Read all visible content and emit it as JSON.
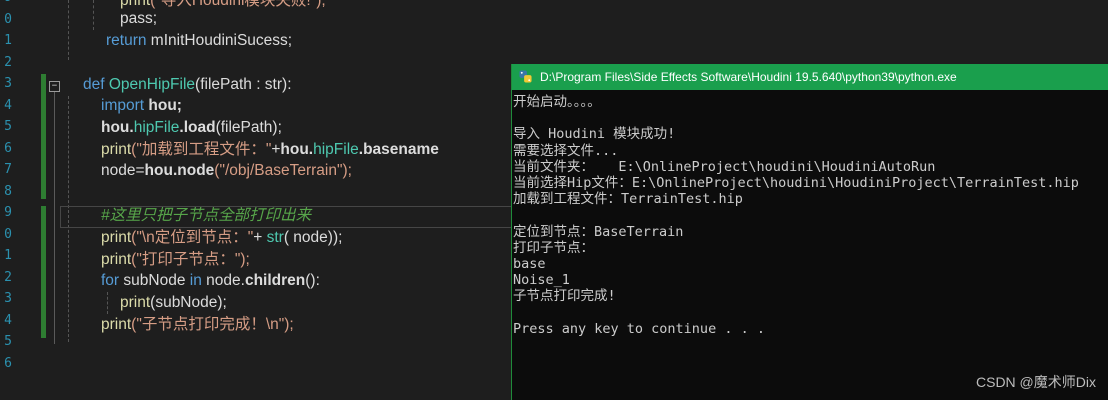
{
  "editor": {
    "line_numbers": [
      "9",
      "0",
      "1",
      "2",
      "3",
      "4",
      "5",
      "6",
      "7",
      "8",
      "9",
      "0",
      "1",
      "2",
      "3",
      "4",
      "5",
      "6"
    ],
    "code": {
      "l0_print": "print",
      "l0_str": "(\"导入Houdini模块失败!\");",
      "l1": "pass;",
      "l2_kw": "return",
      "l2_rest": " mInitHoudiniSucess;",
      "l4_kw": "def",
      "l4_fn": "OpenHipFile",
      "l4_rest": "(filePath : str):",
      "l5_kw": "import",
      "l5_rest": " hou;",
      "l6_a": "hou.",
      "l6_b": "hipFile",
      "l6_c": ".load",
      "l6_d": "(filePath);",
      "l7_print": "print",
      "l7_str": "(\"加载到工程文件：\"",
      "l7_plus": "+",
      "l7_a": "hou.",
      "l7_b": "hipFile",
      "l7_c": ".basename",
      "l8_a": "node=",
      "l8_b": "hou.node",
      "l8_c": "(\"/obj/BaseTerrain\");",
      "l10_cm": "#这里只把子节点全部打印出来",
      "l11_print": "print",
      "l11_str": "(\"\\n定位到节点：\"",
      "l11_plus": "+ ",
      "l11_fn": "str",
      "l11_rest": "( node));",
      "l12_print": "print",
      "l12_str": "(\"打印子节点：\");",
      "l13_kw": "for",
      "l13_a": " subNode ",
      "l13_in": "in",
      "l13_b": " node.",
      "l13_c": "children",
      "l13_d": "():",
      "l14_print": "print",
      "l14_rest": "(subNode);",
      "l15_print": "print",
      "l15_str": "(\"子节点打印完成！\\n\");"
    },
    "fold_glyph": "−"
  },
  "console": {
    "title": "D:\\Program Files\\Side Effects Software\\Houdini 19.5.640\\python39\\python.exe",
    "lines": [
      "开始启动。。。。",
      "",
      "导入 Houdini 模块成功!",
      "需要选择文件...",
      "当前文件夹：   E:\\OnlineProject\\houdini\\HoudiniAutoRun",
      "当前选择Hip文件：E:\\OnlineProject\\houdini\\HoudiniProject\\TerrainTest.hip",
      "加载到工程文件：TerrainTest.hip",
      "",
      "定位到节点：BaseTerrain",
      "打印子节点：",
      "base",
      "Noise_1",
      "子节点打印完成!",
      "",
      "Press any key to continue . . ."
    ]
  },
  "watermark": "CSDN @魔术师Dix",
  "colors": {
    "accent_green": "#1a9f4d",
    "keyword": "#569cd6",
    "type": "#4ec9b0",
    "string": "#d69d85",
    "comment": "#57a64a"
  }
}
